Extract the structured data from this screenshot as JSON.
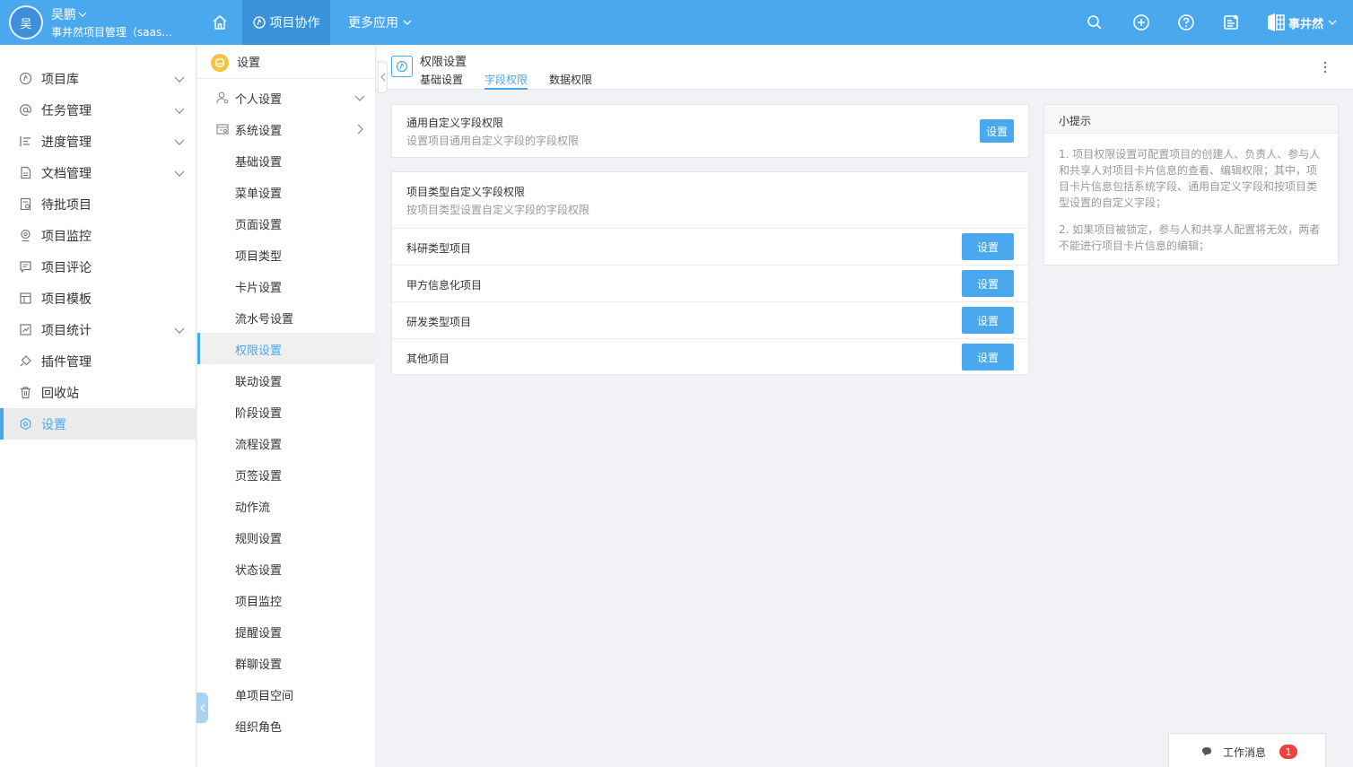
{
  "topbar": {
    "avatar_text": "吴",
    "user_name": "吴鹏",
    "workspace": "事井然项目管理（saas...",
    "nav_active": "项目协作",
    "nav_more": "更多应用",
    "brand_name": "事井然",
    "icons": [
      "home-icon",
      "search-icon",
      "add-circle-icon",
      "help-icon",
      "notice-icon"
    ],
    "accent": "#4aa8ee"
  },
  "sidebar": {
    "items": [
      {
        "label": "项目库",
        "icon": "project-library-icon",
        "has_children": true
      },
      {
        "label": "任务管理",
        "icon": "at-icon",
        "has_children": true
      },
      {
        "label": "进度管理",
        "icon": "progress-icon",
        "has_children": true
      },
      {
        "label": "文档管理",
        "icon": "document-icon",
        "has_children": true
      },
      {
        "label": "待批项目",
        "icon": "approval-icon",
        "has_children": false
      },
      {
        "label": "项目监控",
        "icon": "monitor-icon",
        "has_children": false
      },
      {
        "label": "项目评论",
        "icon": "comment-icon",
        "has_children": false
      },
      {
        "label": "项目模板",
        "icon": "template-icon",
        "has_children": false
      },
      {
        "label": "项目统计",
        "icon": "statistics-icon",
        "has_children": true
      },
      {
        "label": "插件管理",
        "icon": "plugin-icon",
        "has_children": false
      },
      {
        "label": "回收站",
        "icon": "trash-icon",
        "has_children": false
      },
      {
        "label": "设置",
        "icon": "settings-icon",
        "has_children": false,
        "active": true
      }
    ]
  },
  "submenu": {
    "title": "设置",
    "groups": [
      {
        "label": "个人设置",
        "icon": "user-settings-icon",
        "state": "collapsed"
      },
      {
        "label": "系统设置",
        "icon": "system-settings-icon",
        "state": "expanded"
      }
    ],
    "items": [
      "基础设置",
      "菜单设置",
      "页面设置",
      "项目类型",
      "卡片设置",
      "流水号设置",
      "权限设置",
      "联动设置",
      "阶段设置",
      "流程设置",
      "页签设置",
      "动作流",
      "规则设置",
      "状态设置",
      "项目监控",
      "提醒设置",
      "群聊设置",
      "单项目空间",
      "组织角色"
    ],
    "active_item": "权限设置"
  },
  "page": {
    "title": "权限设置",
    "tabs": [
      {
        "label": "基础设置",
        "active": false
      },
      {
        "label": "字段权限",
        "active": true
      },
      {
        "label": "数据权限",
        "active": false
      }
    ]
  },
  "general_card": {
    "title": "通用自定义字段权限",
    "desc": "设置项目通用自定义字段的字段权限",
    "button": "设置"
  },
  "type_card": {
    "title": "项目类型自定义字段权限",
    "desc": "按项目类型设置自定义字段的字段权限",
    "rows": [
      {
        "label": "科研类型项目",
        "button": "设置"
      },
      {
        "label": "甲方信息化项目",
        "button": "设置"
      },
      {
        "label": "研发类型项目",
        "button": "设置"
      },
      {
        "label": "其他项目",
        "button": "设置"
      }
    ]
  },
  "tips": {
    "title": "小提示",
    "items": [
      "1. 项目权限设置可配置项目的创建人、负责人、参与人和共享人对项目卡片信息的查看、编辑权限；其中，项目卡片信息包括系统字段、通用自定义字段和按项目类型设置的自定义字段；",
      "2. 如果项目被锁定，参与人和共享人配置将无效，两者不能进行项目卡片信息的编辑；"
    ]
  },
  "messages": {
    "label": "工作消息",
    "count": "1"
  }
}
